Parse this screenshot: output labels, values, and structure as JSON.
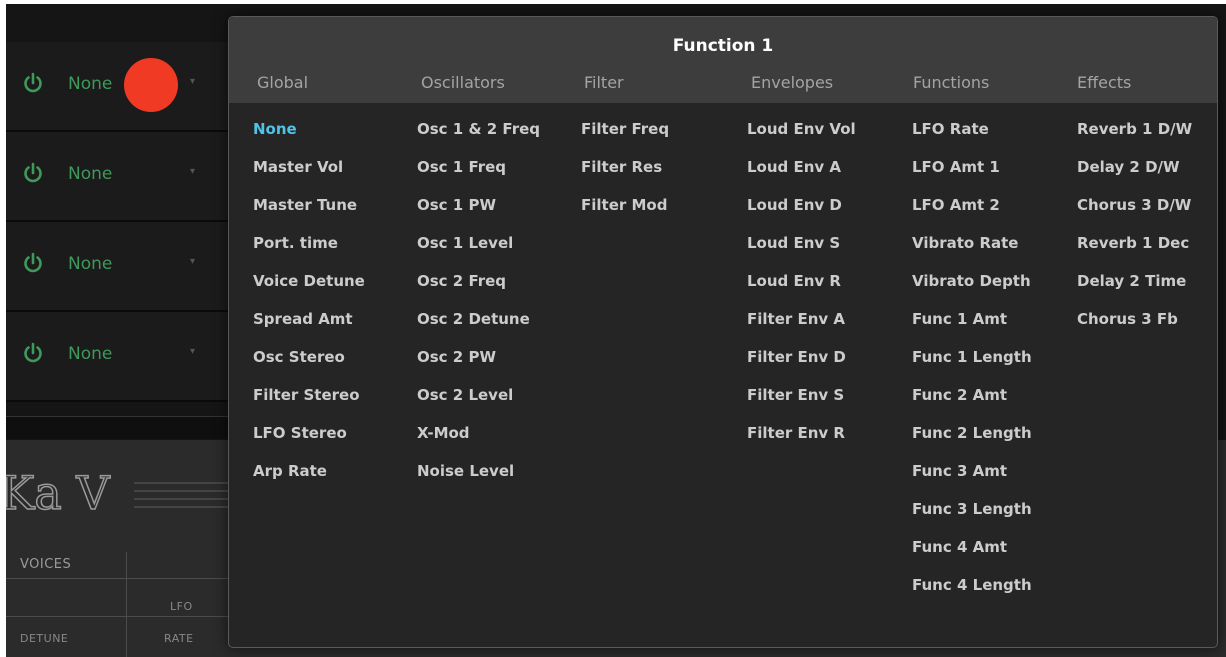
{
  "slots": [
    {
      "label": "None"
    },
    {
      "label": "None"
    },
    {
      "label": "None"
    },
    {
      "label": "None"
    }
  ],
  "synth": {
    "logo": "Ka V",
    "voices_label": "VOICES",
    "lfo_label": "LFO",
    "detune_label": "DETUNE",
    "rate_label": "RATE"
  },
  "menu": {
    "title": "Function 1",
    "columns": [
      {
        "heading": "Global",
        "items": [
          "None",
          "Master Vol",
          "Master Tune",
          "Port. time",
          "Voice Detune",
          "Spread Amt",
          "Osc Stereo",
          "Filter Stereo",
          "LFO Stereo",
          "Arp Rate"
        ]
      },
      {
        "heading": "Oscillators",
        "items": [
          "Osc 1 & 2 Freq",
          "Osc 1 Freq",
          "Osc 1 PW",
          "Osc 1 Level",
          "Osc 2 Freq",
          "Osc 2 Detune",
          "Osc 2 PW",
          "Osc 2 Level",
          "X-Mod",
          "Noise Level"
        ]
      },
      {
        "heading": "Filter",
        "items": [
          "Filter Freq",
          "Filter Res",
          "Filter Mod"
        ]
      },
      {
        "heading": "Envelopes",
        "items": [
          "Loud Env Vol",
          "Loud Env A",
          "Loud Env D",
          "Loud Env S",
          "Loud Env R",
          "Filter Env A",
          "Filter Env D",
          "Filter Env S",
          "Filter Env R"
        ]
      },
      {
        "heading": "Functions",
        "items": [
          "LFO Rate",
          "LFO Amt 1",
          "LFO Amt 2",
          "Vibrato Rate",
          "Vibrato Depth",
          "Func 1 Amt",
          "Func 1 Length",
          "Func 2 Amt",
          "Func 2 Length",
          "Func 3 Amt",
          "Func 3 Length",
          "Func 4 Amt",
          "Func 4 Length"
        ]
      },
      {
        "heading": "Effects",
        "items": [
          "Reverb 1 D/W",
          "Delay 2 D/W",
          "Chorus 3 D/W",
          "Reverb 1 Dec",
          "Delay 2 Time",
          "Chorus 3 Fb"
        ]
      }
    ],
    "selected": "None"
  },
  "colors": {
    "accent_selected": "#4fc3e8",
    "power_green": "#3d9a5a",
    "record_red": "#f03a24"
  },
  "icons": [
    "power-icon",
    "dropdown-arrow-icon",
    "record-dot-icon"
  ]
}
